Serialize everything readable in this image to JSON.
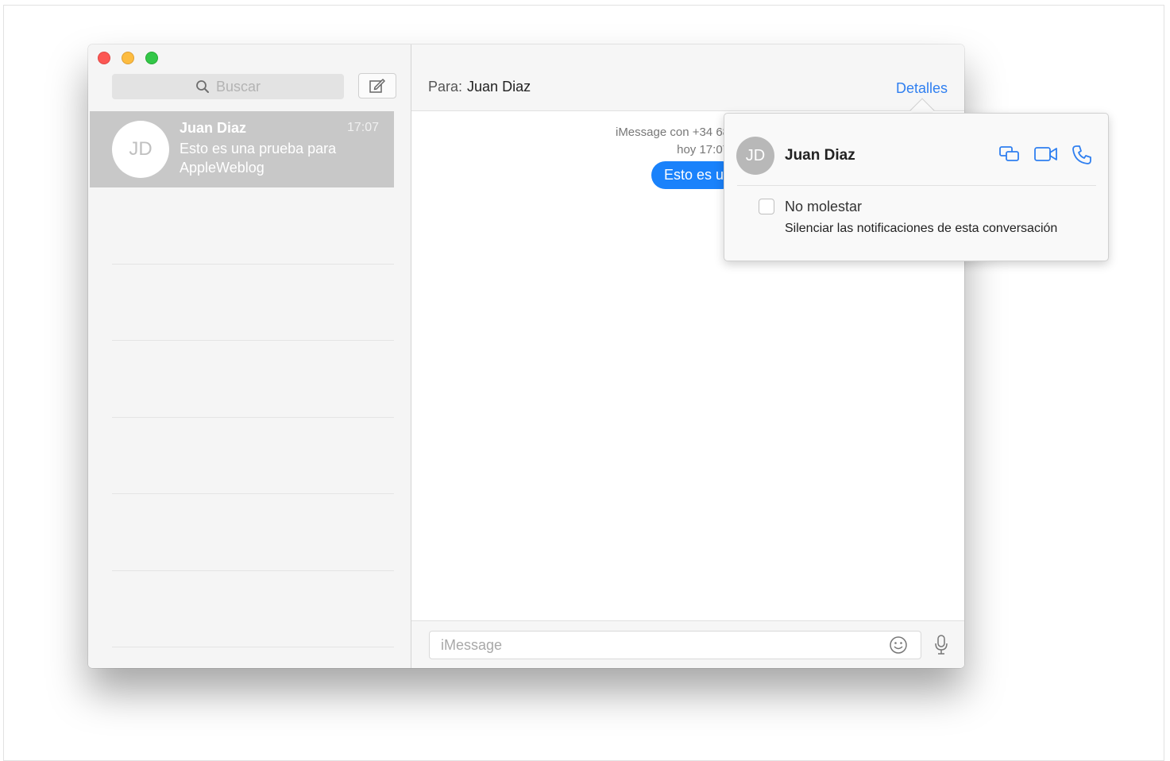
{
  "sidebar": {
    "search_placeholder": "Buscar",
    "conversation": {
      "initials": "JD",
      "name": "Juan Diaz",
      "time": "17:07",
      "preview": "Esto es una prueba para AppleWeblog"
    }
  },
  "header": {
    "to_label": "Para:",
    "to_name": "Juan Diaz",
    "details_label": "Detalles"
  },
  "thread": {
    "meta_line1": "iMessage con +34 68",
    "meta_line2": "hoy 17:07",
    "bubble_text": "Esto es u"
  },
  "composer": {
    "placeholder": "iMessage"
  },
  "popover": {
    "initials": "JD",
    "name": "Juan Diaz",
    "icons": [
      "screen-share-icon",
      "video-call-icon",
      "phone-call-icon"
    ],
    "dnd_label": "No molestar",
    "dnd_description": "Silenciar las notificaciones de esta conversación",
    "dnd_checked": false
  },
  "colors": {
    "accent": "#2f7ff0",
    "bubble": "#1a82fb",
    "selected_row": "#c8c8c8",
    "close": "#fc5753",
    "minimize": "#fdbc40",
    "maximize": "#33c748"
  }
}
